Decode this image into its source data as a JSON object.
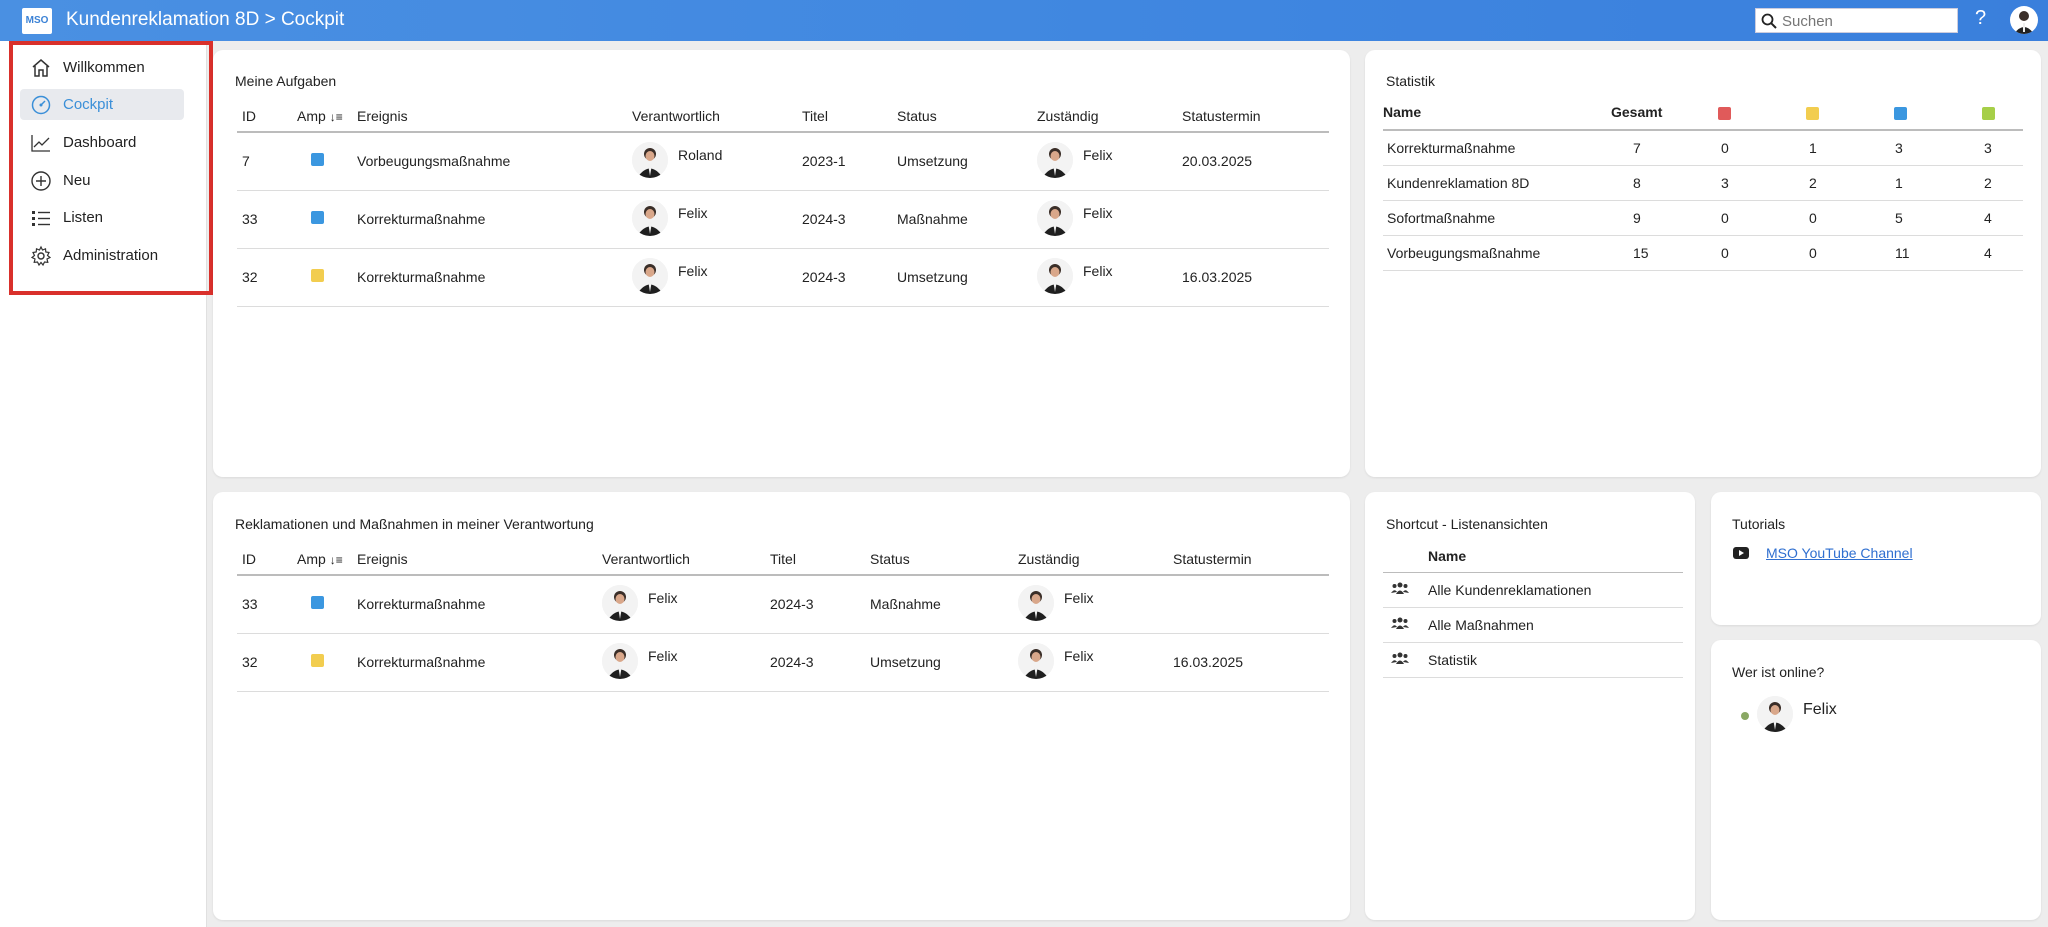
{
  "header": {
    "logo_text": "MSO",
    "title": "Kundenreklamation 8D > Cockpit",
    "search_placeholder": "Suchen",
    "help_label": "?"
  },
  "sidebar": {
    "items": [
      {
        "label": "Willkommen",
        "icon": "home-icon",
        "active": false
      },
      {
        "label": "Cockpit",
        "icon": "gauge-icon",
        "active": true
      },
      {
        "label": "Dashboard",
        "icon": "line-chart-icon",
        "active": false
      },
      {
        "label": "Neu",
        "icon": "plus-circle-icon",
        "active": false
      },
      {
        "label": "Listen",
        "icon": "list-icon",
        "active": false
      },
      {
        "label": "Administration",
        "icon": "gear-icon",
        "active": false
      }
    ]
  },
  "colors": {
    "red": "#e05a5a",
    "yellow": "#f2cd4f",
    "blue": "#3b97e0",
    "green": "#a6cf48",
    "highlight_border": "#d9302b"
  },
  "tasks": {
    "title": "Meine Aufgaben",
    "columns": [
      "ID",
      "Amp",
      "Ereignis",
      "Verantwortlich",
      "Titel",
      "Status",
      "Zuständig",
      "Statustermin"
    ],
    "rows": [
      {
        "id": "7",
        "amp": "blue",
        "ereignis": "Vorbeugungsmaßnahme",
        "verantwortlich": "Roland",
        "titel": "2023-1",
        "status": "Umsetzung",
        "zustaendig": "Felix",
        "termin": "20.03.2025"
      },
      {
        "id": "33",
        "amp": "blue",
        "ereignis": "Korrekturmaßnahme",
        "verantwortlich": "Felix",
        "titel": "2024-3",
        "status": "Maßnahme",
        "zustaendig": "Felix",
        "termin": ""
      },
      {
        "id": "32",
        "amp": "yellow",
        "ereignis": "Korrekturmaßnahme",
        "verantwortlich": "Felix",
        "titel": "2024-3",
        "status": "Umsetzung",
        "zustaendig": "Felix",
        "termin": "16.03.2025"
      }
    ]
  },
  "responsibility": {
    "title": "Reklamationen und Maßnahmen in meiner Verantwortung",
    "columns": [
      "ID",
      "Amp",
      "Ereignis",
      "Verantwortlich",
      "Titel",
      "Status",
      "Zuständig",
      "Statustermin"
    ],
    "rows": [
      {
        "id": "33",
        "amp": "blue",
        "ereignis": "Korrekturmaßnahme",
        "verantwortlich": "Felix",
        "titel": "2024-3",
        "status": "Maßnahme",
        "zustaendig": "Felix",
        "termin": ""
      },
      {
        "id": "32",
        "amp": "yellow",
        "ereignis": "Korrekturmaßnahme",
        "verantwortlich": "Felix",
        "titel": "2024-3",
        "status": "Umsetzung",
        "zustaendig": "Felix",
        "termin": "16.03.2025"
      }
    ]
  },
  "statistik": {
    "title": "Statistik",
    "col_name": "Name",
    "col_total": "Gesamt",
    "rows": [
      {
        "name": "Korrekturmaßnahme",
        "total": "7",
        "red": "0",
        "yellow": "1",
        "blue": "3",
        "green": "3"
      },
      {
        "name": "Kundenreklamation 8D",
        "total": "8",
        "red": "3",
        "yellow": "2",
        "blue": "1",
        "green": "2"
      },
      {
        "name": "Sofortmaßnahme",
        "total": "9",
        "red": "0",
        "yellow": "0",
        "blue": "5",
        "green": "4"
      },
      {
        "name": "Vorbeugungsmaßnahme",
        "total": "15",
        "red": "0",
        "yellow": "0",
        "blue": "11",
        "green": "4"
      }
    ]
  },
  "shortcut": {
    "title": "Shortcut - Listenansichten",
    "col_name": "Name",
    "items": [
      "Alle Kundenreklamationen",
      "Alle Maßnahmen",
      "Statistik"
    ]
  },
  "tutorials": {
    "title": "Tutorials",
    "link": "MSO YouTube Channel"
  },
  "online": {
    "title": "Wer ist online?",
    "users": [
      "Felix"
    ]
  }
}
